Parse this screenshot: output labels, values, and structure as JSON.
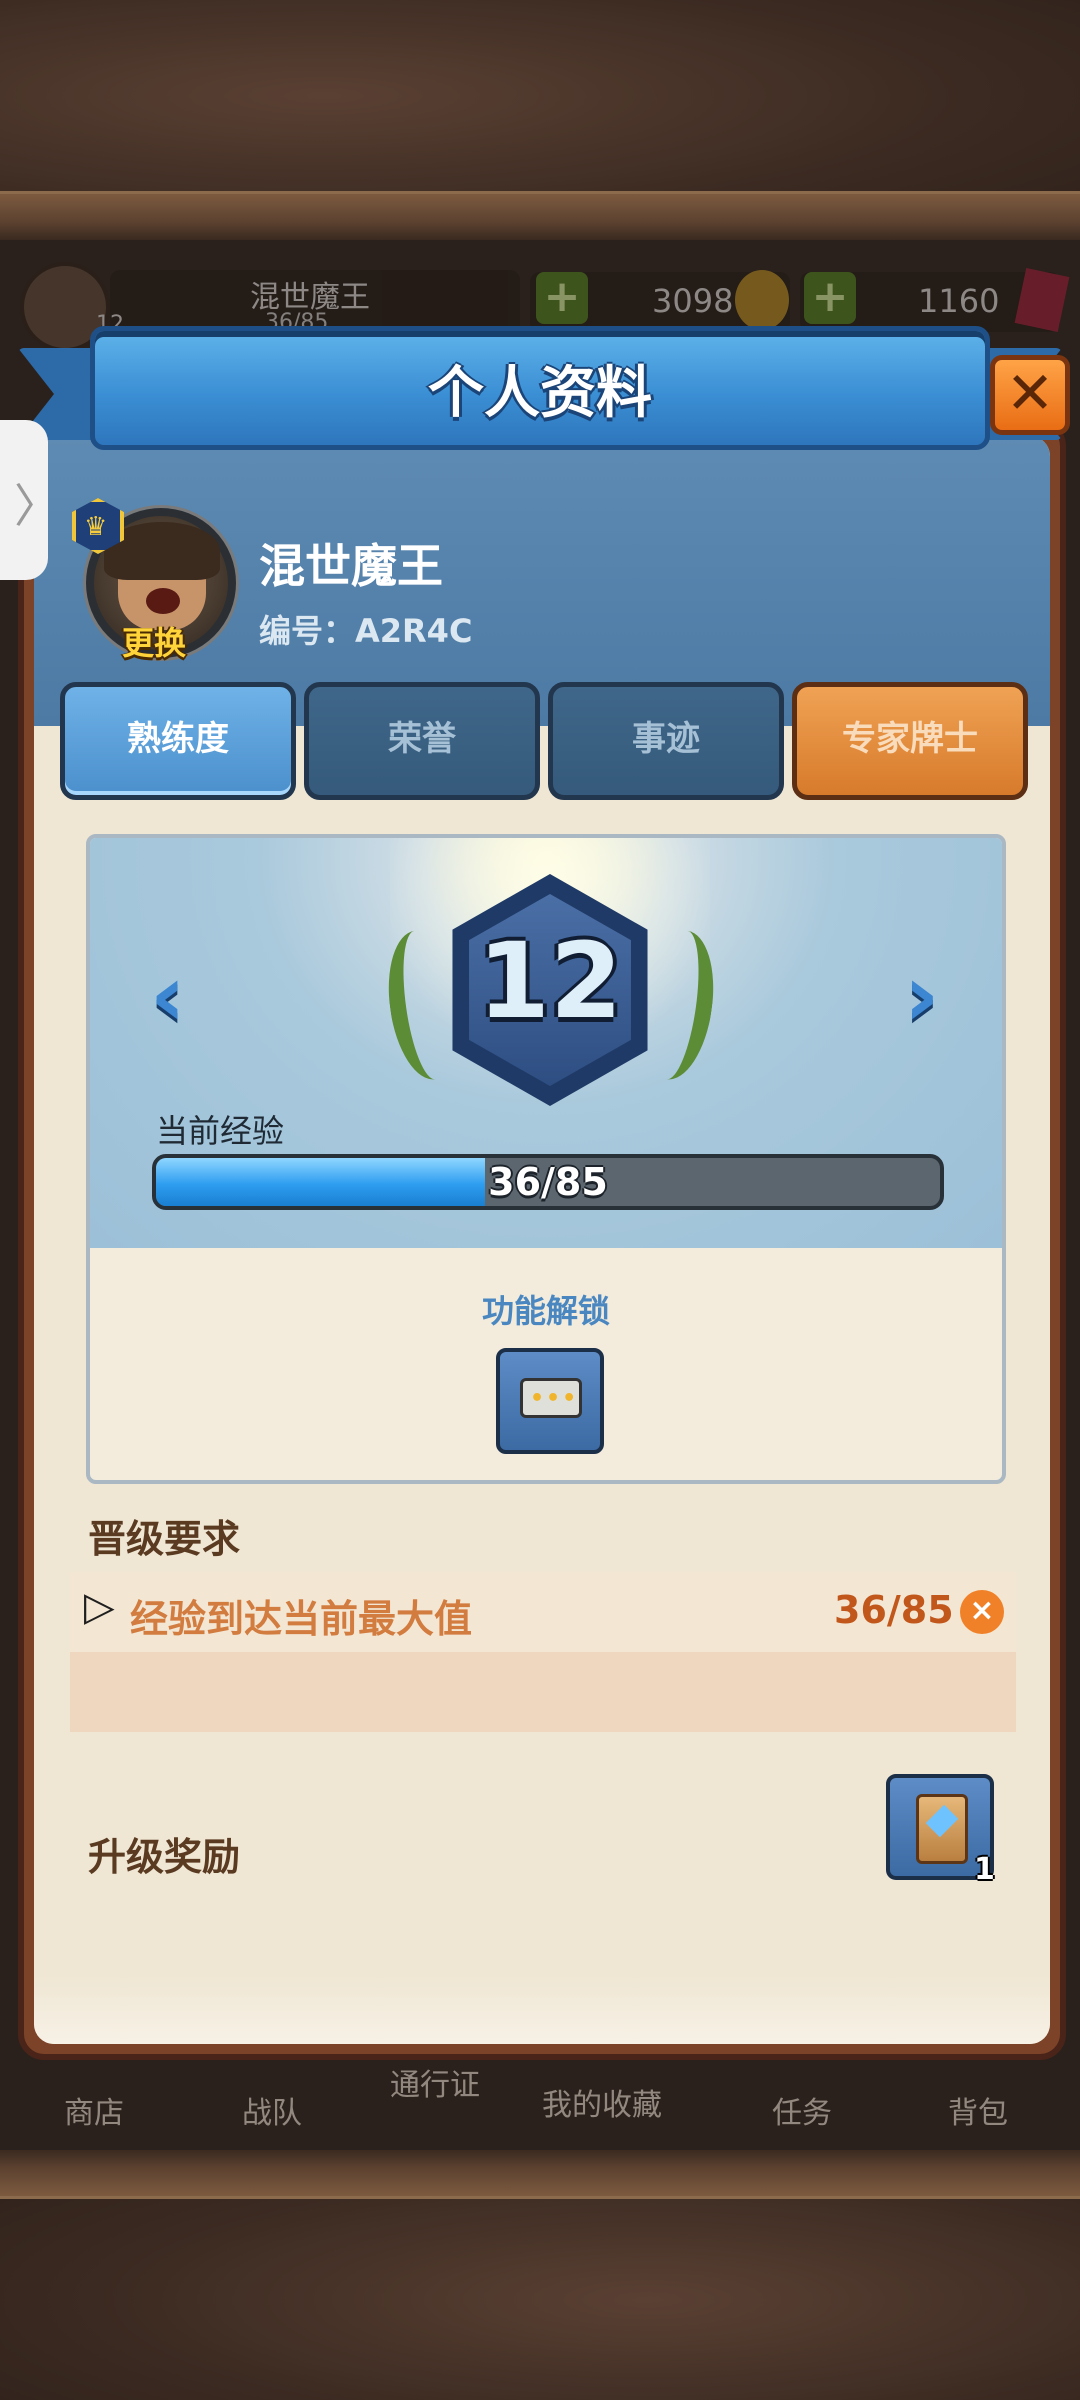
{
  "hud": {
    "level": "12",
    "player_name": "混世魔王",
    "exp": "36/85",
    "coins": "3098",
    "gems": "1160",
    "add_symbol": "+"
  },
  "bottom_nav": {
    "items": [
      "商店",
      "战队",
      "通行证",
      "我的收藏",
      "任务",
      "背包"
    ]
  },
  "side_tab": {
    "glyph": "〉"
  },
  "dialog": {
    "title": "个人资料",
    "close_glyph": "✕"
  },
  "profile": {
    "name": "混世魔王",
    "id_text": "编号：A2R4C",
    "change_label": "更换",
    "crown_glyph": "♛"
  },
  "tabs": [
    {
      "label": "熟练度",
      "active": true
    },
    {
      "label": "荣誉",
      "active": false
    },
    {
      "label": "事迹",
      "active": false
    },
    {
      "label": "专家牌士",
      "active": false
    }
  ],
  "level": {
    "value": "12",
    "prev_glyph": "‹",
    "next_glyph": "›",
    "exp_label": "当前经验",
    "exp_text": "36/85",
    "exp_progress": 0.42,
    "unlock_title": "功能解锁",
    "unlock_icon": "chat-bubble-icon",
    "unlock_dots": "•••"
  },
  "requirements": {
    "title": "晋级要求",
    "items": [
      {
        "arrow": "▷",
        "text": "经验到达当前最大值",
        "value": "36/85",
        "status_glyph": "×"
      }
    ]
  },
  "reward": {
    "title": "升级奖励",
    "item_icon": "card-pack-icon",
    "count": "1"
  },
  "colors": {
    "banner_blue": "#3b8fd4",
    "tab_active": "#4b8fcc",
    "tab_orange": "#d77a2b",
    "req_text": "#d27c40",
    "req_value": "#c2571c",
    "exp_fill": "#2e9df0",
    "close_orange": "#e96d14"
  }
}
